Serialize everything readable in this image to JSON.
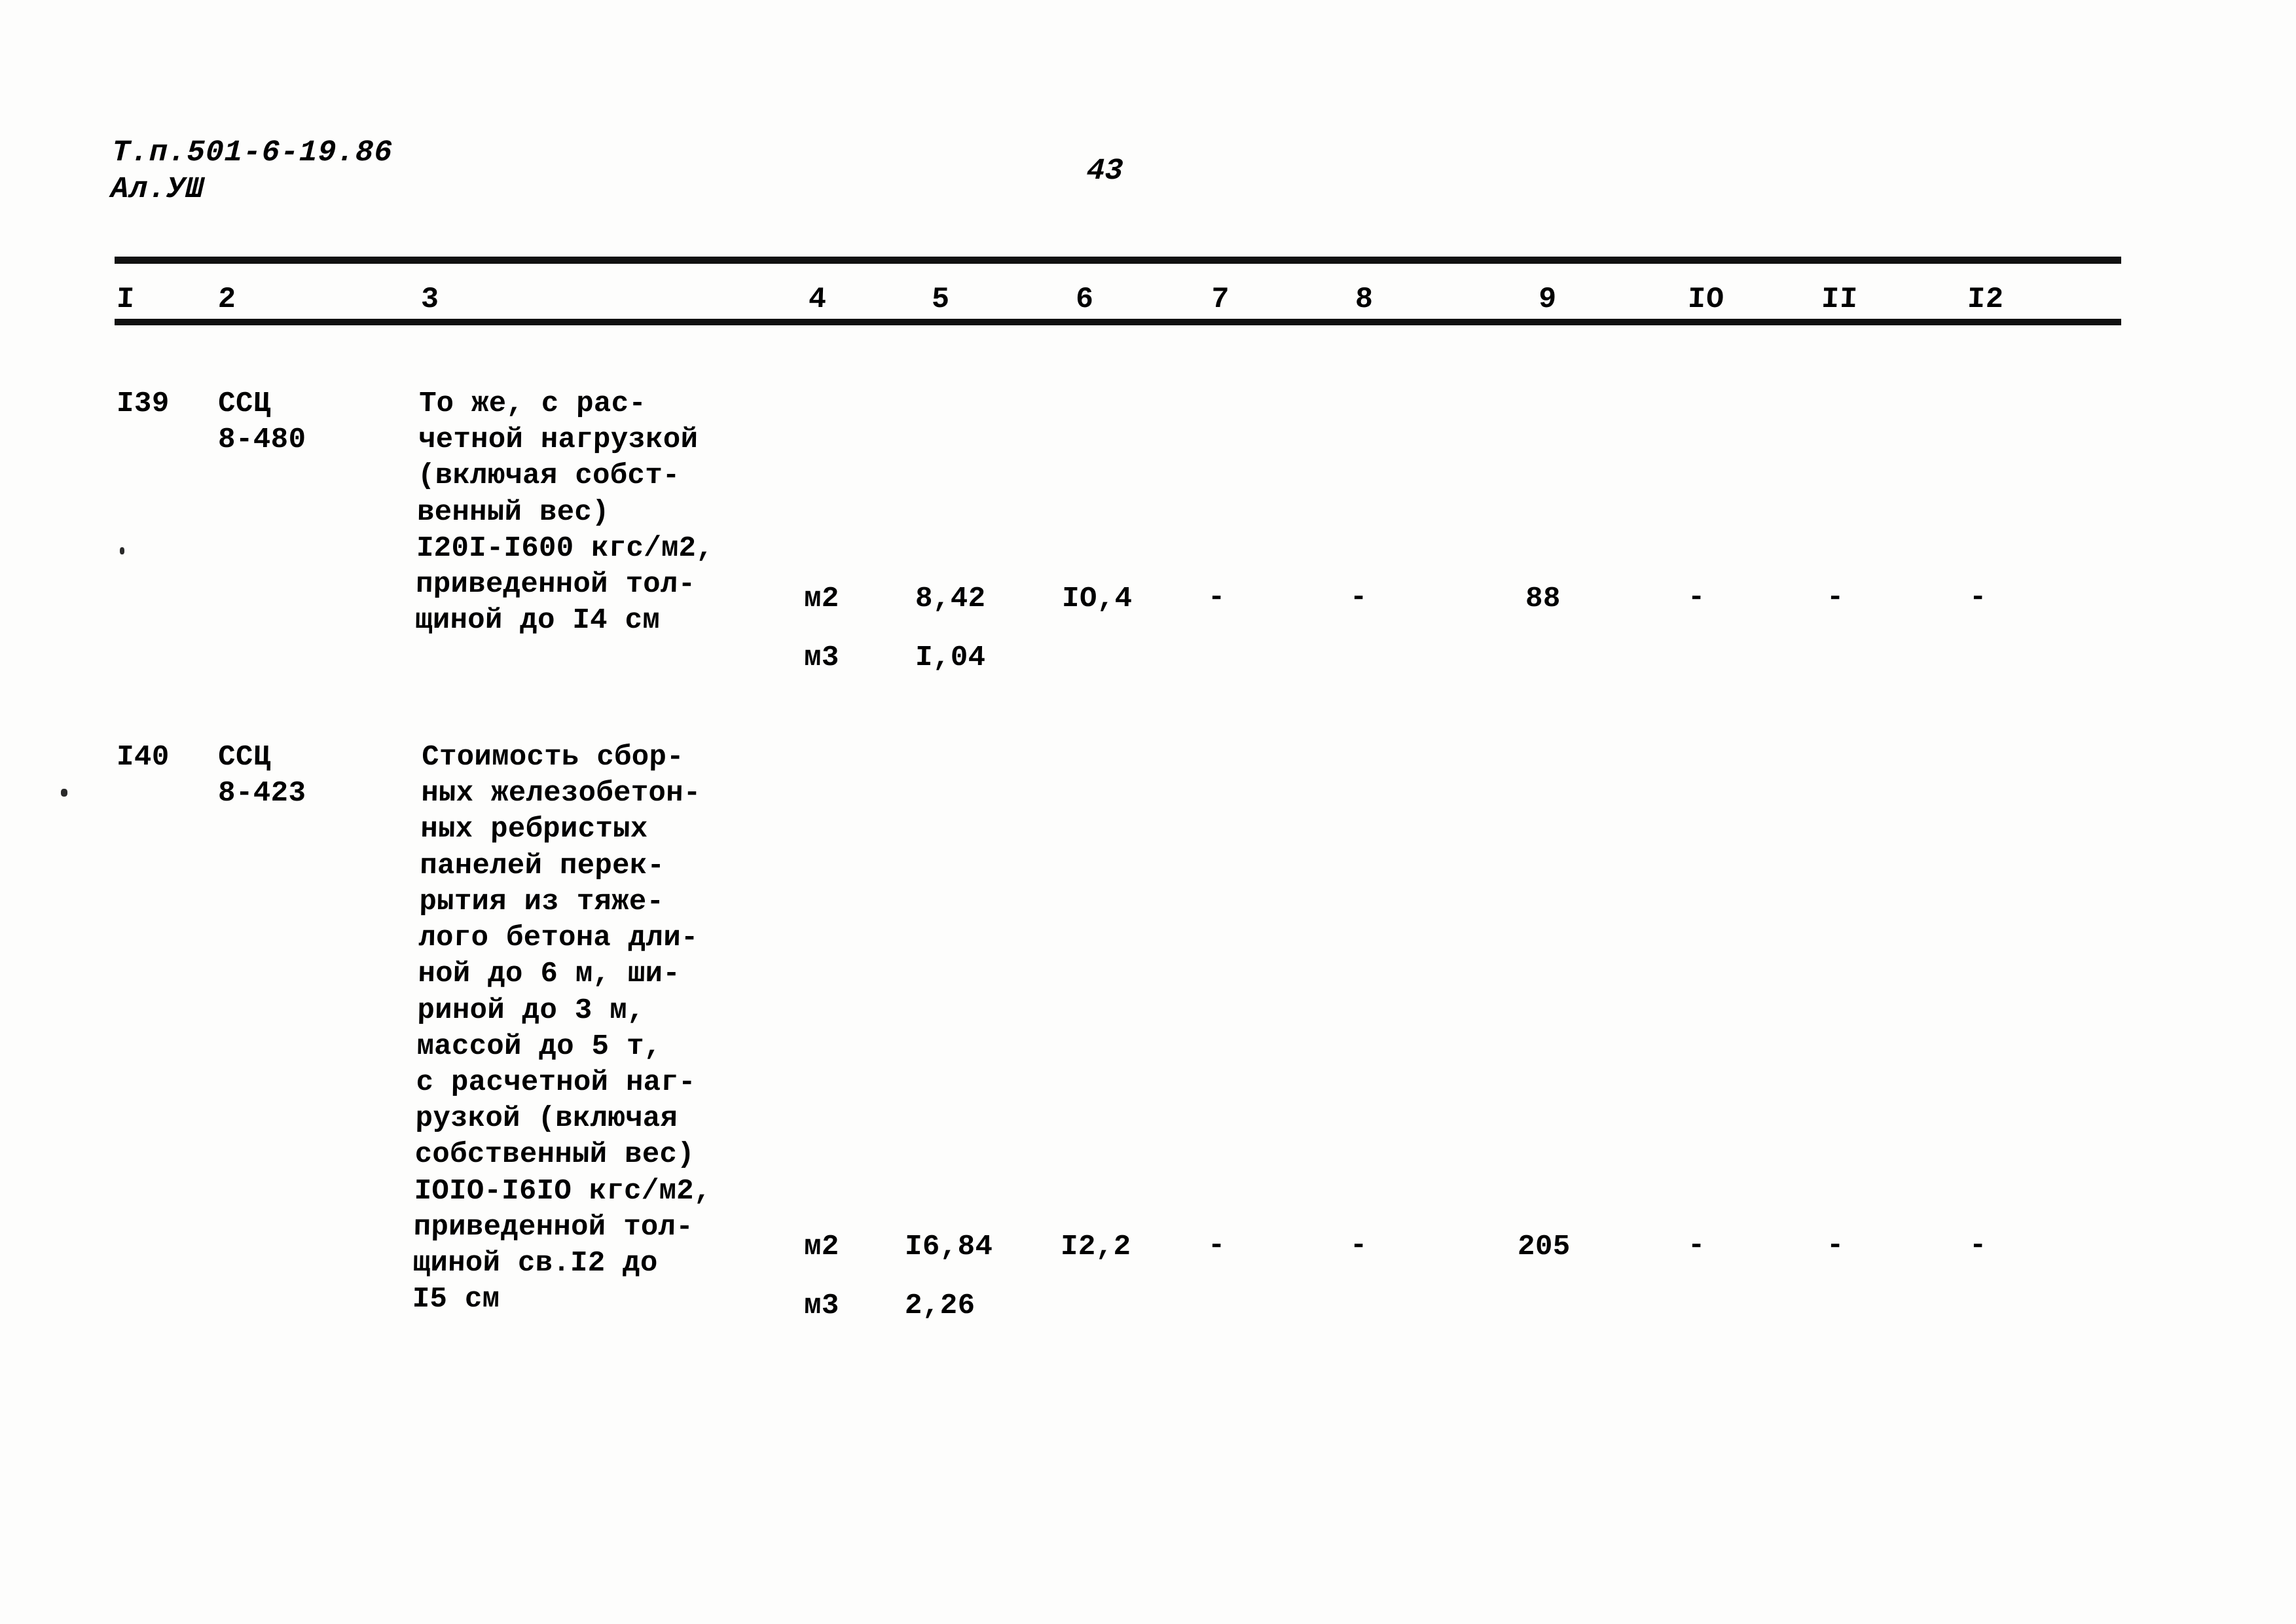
{
  "header": {
    "doc_code_line1": "Т.п.501-6-19.86",
    "doc_code_line2": "Ал.УШ",
    "page_number": "43"
  },
  "table": {
    "column_headers": [
      "I",
      "2",
      "3",
      "4",
      "5",
      "6",
      "7",
      "8",
      "9",
      "IO",
      "II",
      "I2"
    ],
    "rows": [
      {
        "num": "I39",
        "code_line1": "ССЦ",
        "code_line2": "8-480",
        "description": "То же, с рас-\nчетной нагрузкой\n(включая собст-\nвенный вес)\nI20I-I600 кгс/м2,\nприведенной тол-\nщиной до I4 см",
        "measure_primary": "м2",
        "col5_primary": "8,42",
        "col6_primary": "IO,4",
        "col7_primary": "-",
        "col8_primary": "-",
        "col9_primary": "88",
        "col10_primary": "-",
        "col11_primary": "-",
        "col12_primary": "-",
        "measure_secondary": "м3",
        "col5_secondary": "I,04"
      },
      {
        "num": "I40",
        "code_line1": "ССЦ",
        "code_line2": "8-423",
        "description": "Стоимость сбор-\nных железобетон-\nных ребристых\nпанелей перек-\nрытия из тяже-\nлого бетона дли-\nной до 6 м, ши-\nриной до 3 м,\nмассой до 5 т,\nс расчетной наг-\nрузкой (включая\nсобственный вес)\nIOIO-I6IO кгс/м2,\nприведенной тол-\nщиной св.I2 до\nI5 см",
        "measure_primary": "м2",
        "col5_primary": "I6,84",
        "col6_primary": "I2,2",
        "col7_primary": "-",
        "col8_primary": "-",
        "col9_primary": "205",
        "col10_primary": "-",
        "col11_primary": "-",
        "col12_primary": "-",
        "measure_secondary": "м3",
        "col5_secondary": "2,26"
      }
    ]
  }
}
